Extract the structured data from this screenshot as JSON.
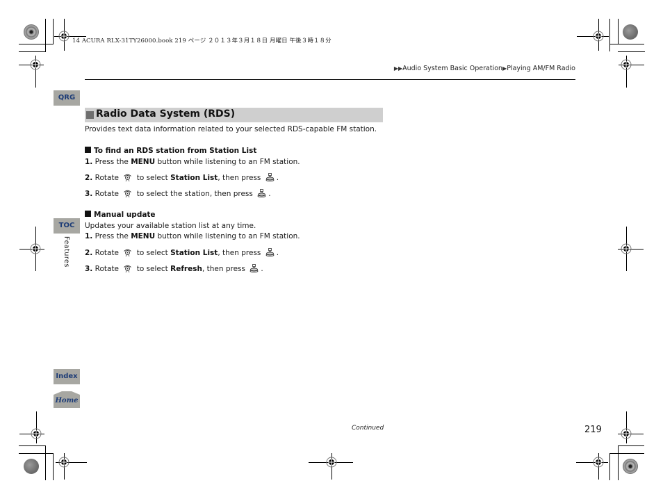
{
  "print_meta": {
    "text": "14 ACURA RLX-31TY26000.book  219 ページ  ２０１３年３月１８日  月曜日  午後３時１８分"
  },
  "breadcrumb": {
    "items": [
      "Audio System Basic Operation",
      "Playing AM/FM Radio"
    ],
    "arrow_icon": "double-triangle-right-icon"
  },
  "side_nav": {
    "qrg": "QRG",
    "toc": "TOC",
    "chapter": "Features",
    "index": "Index",
    "home": "Home"
  },
  "section": {
    "title": "Radio Data System (RDS)",
    "intro": "Provides text data information related to your selected RDS-capable FM station."
  },
  "subsections": [
    {
      "heading": "To find an RDS station from Station List",
      "steps": [
        {
          "num": "1.",
          "pre": "Press the ",
          "bold": "MENU",
          "post": " button while listening to an FM station."
        },
        {
          "num": "2.",
          "pre": "Rotate ",
          "mid": " to select ",
          "bold": "Station List",
          "post": ", then press "
        },
        {
          "num": "3.",
          "pre": "Rotate ",
          "mid": " to select the station, then press "
        }
      ]
    },
    {
      "heading": "Manual update",
      "intro": "Updates your available station list at any time.",
      "steps": [
        {
          "num": "1.",
          "pre": "Press the ",
          "bold": "MENU",
          "post": " button while listening to an FM station."
        },
        {
          "num": "2.",
          "pre": "Rotate ",
          "mid": " to select ",
          "bold": "Station List",
          "post": ", then press "
        },
        {
          "num": "3.",
          "pre": "Rotate ",
          "mid": " to select ",
          "bold": "Refresh",
          "post": ", then press "
        }
      ]
    }
  ],
  "footer": {
    "continued": "Continued",
    "page_number": "219"
  },
  "colors": {
    "tab_bg": "#a7a7a2",
    "tab_text": "#1c3b76",
    "section_bar": "#cfcfcf"
  }
}
